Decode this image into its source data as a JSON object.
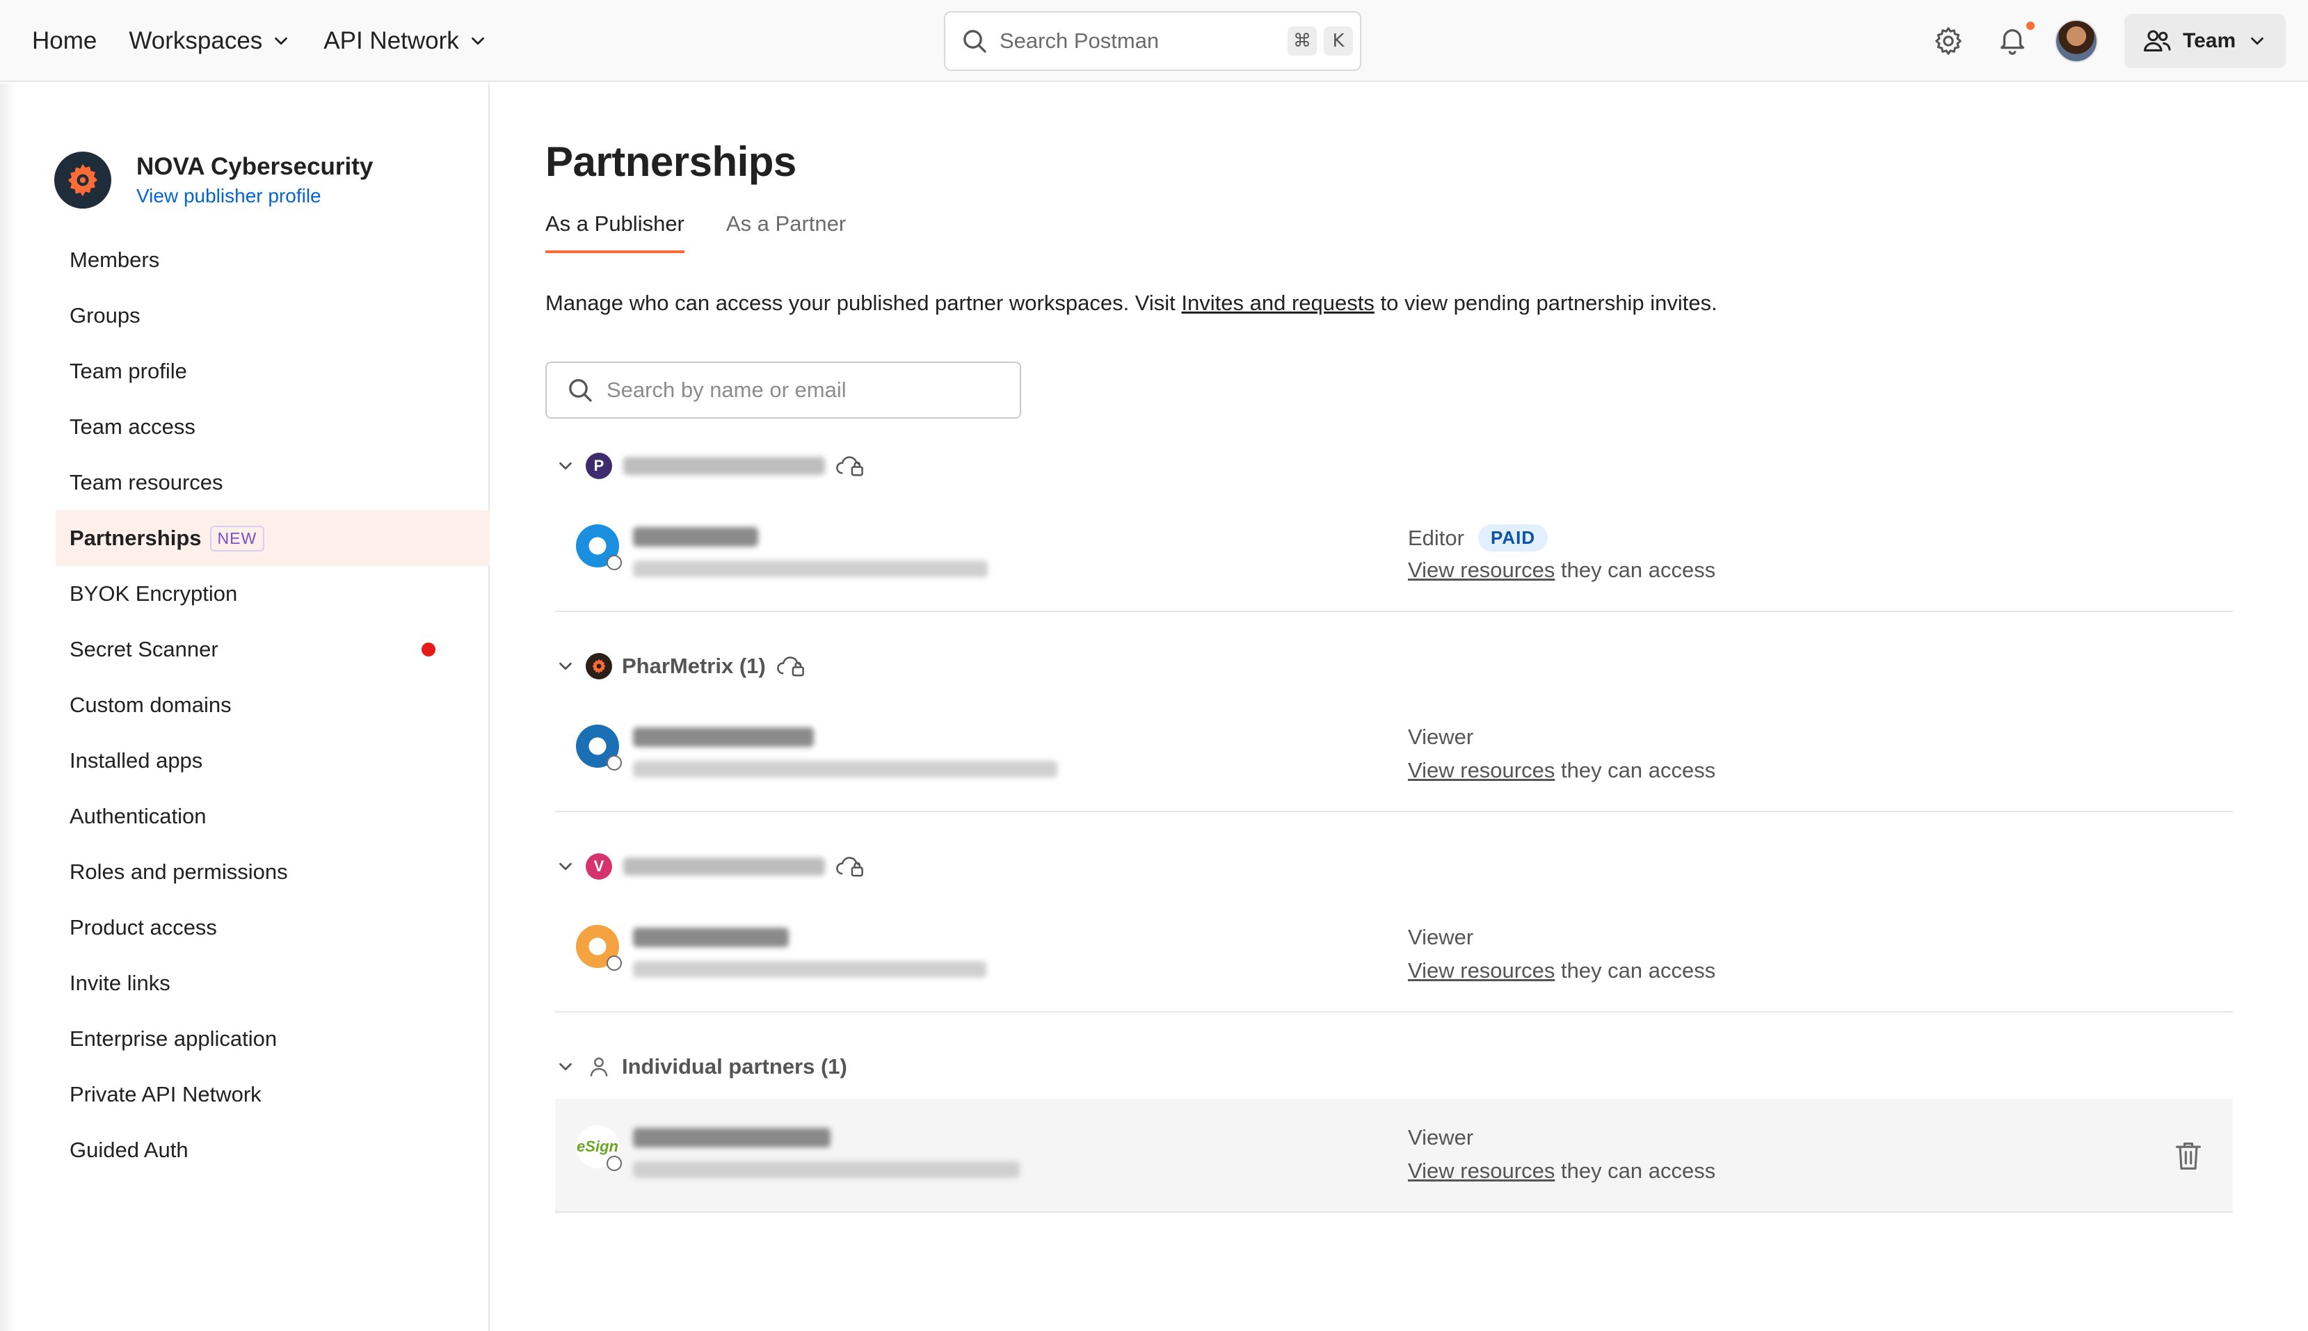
{
  "topbar": {
    "nav": [
      {
        "label": "Home"
      },
      {
        "label": "Workspaces"
      },
      {
        "label": "API Network"
      }
    ],
    "search_placeholder": "Search Postman",
    "shortcut_keys": [
      "⌘",
      "K"
    ],
    "team_label": "Team"
  },
  "sidebar": {
    "org_name": "NOVA Cybersecurity",
    "org_link": "View publisher profile",
    "items": [
      {
        "label": "Members"
      },
      {
        "label": "Groups"
      },
      {
        "label": "Team profile"
      },
      {
        "label": "Team access"
      },
      {
        "label": "Team resources"
      },
      {
        "label": "Partnerships",
        "badge": "NEW"
      },
      {
        "label": "BYOK Encryption"
      },
      {
        "label": "Secret Scanner"
      },
      {
        "label": "Custom domains"
      },
      {
        "label": "Installed apps"
      },
      {
        "label": "Authentication"
      },
      {
        "label": "Roles and permissions"
      },
      {
        "label": "Product access"
      },
      {
        "label": "Invite links"
      },
      {
        "label": "Enterprise application"
      },
      {
        "label": "Private API Network"
      },
      {
        "label": "Guided Auth"
      }
    ]
  },
  "main": {
    "title": "Partnerships",
    "tabs": [
      {
        "label": "As a Publisher"
      },
      {
        "label": "As a Partner"
      }
    ],
    "desc_before": "Manage who can access your published partner workspaces. Visit ",
    "desc_link": "Invites and requests",
    "desc_after": " to view pending partnership invites.",
    "search_placeholder": "Search by name or email",
    "groups": [
      {
        "initial": "P",
        "color": "#3d2b6e",
        "members": [
          {
            "role": "Editor",
            "badge": "PAID"
          }
        ]
      },
      {
        "name": "PharMetrix (1)",
        "color": "#2b1f1a",
        "members": [
          {
            "role": "Viewer"
          }
        ]
      },
      {
        "initial": "V",
        "color": "#d6336c",
        "members": [
          {
            "role": "Viewer"
          }
        ]
      },
      {
        "name": "Individual partners (1)",
        "members": [
          {
            "role": "Viewer",
            "logo_text": "eSign"
          }
        ]
      }
    ],
    "access_link": "View resources",
    "access_suffix": " they can access"
  }
}
